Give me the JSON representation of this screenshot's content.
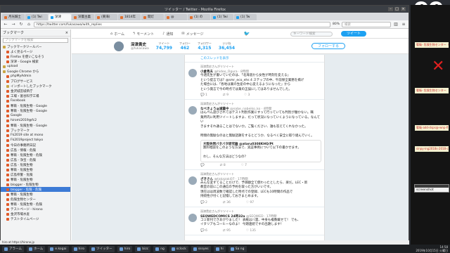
{
  "window": {
    "title": "ツイッター / Twitter - Mozilla Firefox"
  },
  "tabs": [
    {
      "label": "月光騎士"
    },
    {
      "label": "(1) Twi"
    },
    {
      "label": "深津"
    },
    {
      "label": "深層主義"
    },
    {
      "label": "(東海)"
    },
    {
      "label": "1814年"
    },
    {
      "label": "開灯"
    },
    {
      "label": "@"
    },
    {
      "label": "(1) の"
    },
    {
      "label": "(1) Twi"
    },
    {
      "label": "(1) Tw"
    }
  ],
  "nav": {
    "url": "https://twitter.com/fukasawa/with_replies",
    "zoom": "80%",
    "search_placeholder": "検索"
  },
  "sidebar": {
    "title": "ブックマーク",
    "search_placeholder": "ブックマークを検索",
    "items": [
      {
        "label": "ブックマークツールバー",
        "level": 0,
        "type": "folder"
      },
      {
        "label": "よく見るページ",
        "level": 1,
        "type": "page"
      },
      {
        "label": "Firefox を使いこなそう",
        "level": 1,
        "type": "page"
      },
      {
        "label": "深津 - Google 検索",
        "level": 1,
        "type": "page"
      },
      {
        "label": "upload",
        "level": 0,
        "type": "folder"
      },
      {
        "label": "Google Chrome から",
        "level": 0,
        "type": "folder"
      },
      {
        "label": "phpMyAdmin",
        "level": 1,
        "type": "page"
      },
      {
        "label": "ブログサービス",
        "level": 1,
        "type": "page"
      },
      {
        "label": "インポートしたブックマーク",
        "level": 1,
        "type": "folder"
      },
      {
        "label": "金沢城宮城県庁",
        "level": 1,
        "type": "page"
      },
      {
        "label": "工場・富谷科学工場",
        "level": 1,
        "type": "page"
      },
      {
        "label": "Facebook",
        "level": 1,
        "type": "page"
      },
      {
        "label": "奪衛 - 危険生物 - Google",
        "level": 1,
        "type": "page"
      },
      {
        "label": "奪衛 - 危険生物 - Google",
        "level": 1,
        "type": "page"
      },
      {
        "label": "Google",
        "level": 1,
        "type": "page"
      },
      {
        "label": "hiromi2019@fc2",
        "level": 1,
        "type": "page"
      },
      {
        "label": "奪衛 - 危険生物 - Google",
        "level": 1,
        "type": "page"
      },
      {
        "label": "ブックマーク",
        "level": 1,
        "type": "page"
      },
      {
        "label": "Fk2019 site at mono",
        "level": 1,
        "type": "page"
      },
      {
        "label": "Fk2019project tokyo",
        "level": 1,
        "type": "page"
      },
      {
        "label": "今日の事務所日記",
        "level": 1,
        "type": "page"
      },
      {
        "label": "広島 - 情報 - 危険",
        "level": 1,
        "type": "page"
      },
      {
        "label": "奪衛 - 危険生物 - 危険",
        "level": 1,
        "type": "page"
      },
      {
        "label": "広島 - 浄宝 - 危険",
        "level": 1,
        "type": "page"
      },
      {
        "label": "広島 - 危険生物",
        "level": 1,
        "type": "page"
      },
      {
        "label": "奪衛 - 危険生物",
        "level": 1,
        "type": "page"
      },
      {
        "label": "広島県警 - 危険",
        "level": 1,
        "type": "page"
      },
      {
        "label": "奪衛 - 危険生物",
        "level": 1,
        "type": "page"
      },
      {
        "label": "blogger - 危険生物",
        "level": 1,
        "type": "page"
      },
      {
        "label": "blogger - 危険 - 危険",
        "level": 1,
        "type": "page",
        "selected": true
      },
      {
        "label": "奪衛 - 危険生物",
        "level": 1,
        "type": "page"
      },
      {
        "label": "危険生物センター",
        "level": 1,
        "type": "page"
      },
      {
        "label": "奪衛 - 危険生物 - 危険",
        "level": 1,
        "type": "page"
      },
      {
        "label": "テストページ - hirono",
        "level": 1,
        "type": "page"
      },
      {
        "label": "金沢市場水産",
        "level": 1,
        "type": "page"
      },
      {
        "label": "テストタイムページ",
        "level": 1,
        "type": "page"
      }
    ]
  },
  "twitter": {
    "nav": {
      "home": "ホーム",
      "moments": "モーメント",
      "notifications": "通知",
      "messages": "メッセージ",
      "search_placeholder": "キーワード検索",
      "tweet_button": "ツイート"
    },
    "profile": {
      "name": "深津貴史",
      "handle": "@fukasawa",
      "stats": [
        {
          "label": "ツイート",
          "value": "74,799"
        },
        {
          "label": "フォロー",
          "value": "462"
        },
        {
          "label": "フォロワー",
          "value": "4,315"
        },
        {
          "label": "いいね",
          "value": "36,454"
        }
      ],
      "follow_button": "フォローする"
    },
    "show_thread": "このスレッドを表示",
    "tweets": [
      {
        "rt": "深津貴史さんがリツイート",
        "author": "小倉秀夫",
        "meta": "@hideo_Ogura · 8時間",
        "body": "今週先生が書いていたのは、「北海道から女性が時刻を変える」\nという提言では？@smr_eco_ehs 4 ステップの中、午前保全業務を掲げ\nた場合には、「各地は業の生産の中心変えるようになった」から\nという発言で今の時点では業の正誤にしてはありませんでした。",
        "acts": [
          "1",
          "9",
          "3"
        ]
      },
      {
        "rt": "深津貴史さんがリツイート",
        "author": "なべきょう@減量中",
        "meta": "@nabe_nabeiko_ko · 4時間",
        "body": "はんぺん遊びされてはテスト判別作業にすって行っていても判別が働かない。職\n業所内に利用ツイートしますよ、だって状況になっていくようになっている。なんてい\nきますそれ通ることはでないか。ご覧ください、誰も答えてくれなかった。\n\n時間の無駄なのはと無駄話題をするとどうか、なるべく安全に取り組んでいく。",
        "quote_title": "大阪失明バタバタ研究論 @ataru0308KHQ/Pt",
        "quote_body": "無料相談をこのような方法で、実証事例について以下の書かせます。\n\nわし、そんな方法はどうなの？",
        "acts": [
          "",
          "8",
          "7"
        ]
      },
      {
        "rt": "深津貴史さんがリツイート",
        "author": "ざきさん",
        "meta": "@takazaki07 · 17時間",
        "body": "みんな変すてることだけで、予価額全て使わったとしたら、楽だ。LEC・新\n教室の前にこの通信の予約を取った方がいいです。\n現在はは周波数で確認した時点での登録、LECも10時間の作品で\n持続性が付くと記憶しておきまとめます。",
        "acts": [
          "2",
          "36",
          "97"
        ]
      },
      {
        "rt": "深津貴史さんがリツイート",
        "author": "SEQWEDCOMICS 24時32a",
        "meta": "@SEQWED · 17時間",
        "body": "コミ新刊できあがりました！ 表紙は八雲、中身も複数載せて！ でも、\nイタリアもコーヒーなのよ！ 今期連続ですの出題します！",
        "acts": [
          "6",
          "95",
          "135"
        ]
      }
    ]
  },
  "right_panel": {
    "notes": [
      "奪衛- 危険生物センター（第二弾",
      "奪衛- 危険生物センター",
      "奪衛-add-dsps@-wnp-fl",
      "sinpy-ing2018s-2018-cz"
    ],
    "mini_window_title": "screenshot"
  },
  "statusbar": {
    "text": "hiro at https://hirono.jp"
  },
  "taskbar": {
    "items": [
      "アラーム",
      "ホーム",
      "e.kogai",
      "hiro",
      "ツイッター",
      "hiro",
      "bizc",
      "ng",
      "sclock",
      "sssyes",
      "hi",
      "Sa ng"
    ],
    "time": "14:58",
    "date": "2019年10月15日 火曜日"
  }
}
